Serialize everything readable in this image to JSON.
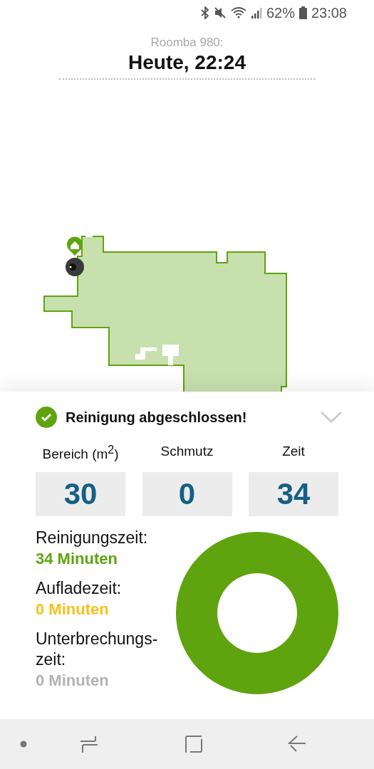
{
  "status_bar": {
    "battery": "62%",
    "time": "23:08"
  },
  "header": {
    "device": "Roomba 980:",
    "title": "Heute, 22:24"
  },
  "map": {
    "kind": "floor-map"
  },
  "summary": {
    "title": "Reinigung abgeschlossen!",
    "expanded": false
  },
  "stats": [
    {
      "label": "Bereich (m$^{2}$)",
      "value": "30"
    },
    {
      "label": "Schmutz",
      "value": "0"
    },
    {
      "label": "Zeit",
      "value": "34"
    }
  ],
  "legend": [
    {
      "label": "Reinigungszeit:",
      "value": "34 Minuten",
      "color": "#5fa40f"
    },
    {
      "label": "Aufladezeit:",
      "value": "0 Minuten",
      "color": "#f7c21c"
    },
    {
      "label": "Unterbrechungs-zeit:",
      "value": "0 Minuten",
      "color": "#b3b3b3"
    }
  ]
}
